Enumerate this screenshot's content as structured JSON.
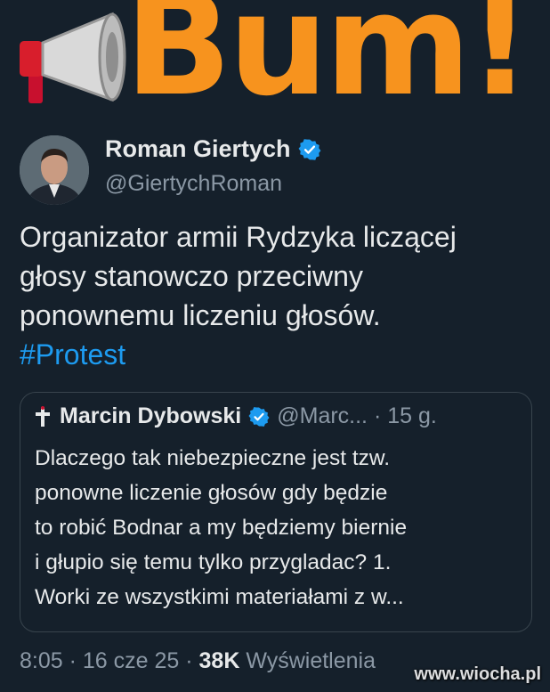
{
  "banner": {
    "headline": "Bum!",
    "icon": "megaphone-icon",
    "color": "#f7931e"
  },
  "tweet": {
    "author_name": "Roman Giertych",
    "author_handle": "@GiertychRoman",
    "lines": [
      "Organizator armii Rydzyka liczącej",
      "głosy stanowczo przeciwny",
      "ponownemu liczeniu głosów."
    ],
    "hashtag": "#Protest"
  },
  "quote": {
    "author_name": "Marcin Dybowski",
    "meta": "@Marc... · 15 g.",
    "lines": [
      "Dlaczego tak niebezpieczne jest tzw.",
      "ponowne liczenie głosów gdy będzie",
      "to robić Bodnar a my będziemy biernie",
      "i głupio się temu tylko przygladac? 1.",
      "Worki ze wszystkimi materiałami z w..."
    ]
  },
  "footer": {
    "time": "8:05 · 16 cze 25 · ",
    "views": "38K",
    "views_label": " Wyświetlenia"
  },
  "watermark": "www.wiocha.pl",
  "colors": {
    "background": "#15202b",
    "link": "#1d9bf0",
    "verified": "#1d9bf0",
    "muted": "#8b98a5"
  }
}
